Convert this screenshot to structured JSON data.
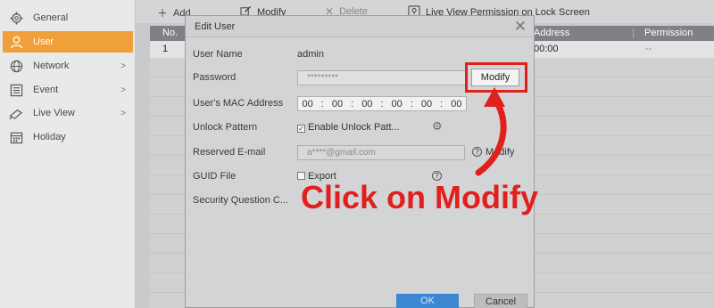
{
  "sidebar": {
    "items": [
      {
        "label": "General",
        "icon": "gear-icon"
      },
      {
        "label": "User",
        "icon": "user-icon",
        "active": true
      },
      {
        "label": "Network",
        "icon": "globe-icon",
        "chevron": ">"
      },
      {
        "label": "Event",
        "icon": "list-icon",
        "chevron": ">"
      },
      {
        "label": "Live View",
        "icon": "camera-icon",
        "chevron": ">"
      },
      {
        "label": "Holiday",
        "icon": "calendar-icon"
      }
    ]
  },
  "toolbar": {
    "add_label": "Add",
    "modify_label": "Modify",
    "delete_label": "Delete",
    "live_view_label": "Live View Permission on Lock Screen"
  },
  "table": {
    "headers": {
      "no": "No.",
      "address": "Address",
      "permission": "Permission"
    },
    "rows": [
      {
        "no": "1",
        "address": "00:00",
        "permission": "--"
      }
    ]
  },
  "dialog": {
    "title": "Edit User",
    "close_glyph": "✕",
    "user_name_label": "User Name",
    "user_name_value": "admin",
    "password_label": "Password",
    "password_value": "*********",
    "modify_label": "Modify",
    "mac_label": "User's MAC Address",
    "mac_octets": [
      "00",
      "00",
      "00",
      "00",
      "00",
      "00"
    ],
    "mac_separator": ":",
    "unlock_label": "Unlock Pattern",
    "unlock_checkbox_label": "Enable Unlock Patt...",
    "reserved_email_label": "Reserved E-mail",
    "reserved_email_value": "a****@gmail.com",
    "email_modify_label": "Modify",
    "guid_label": "GUID File",
    "guid_checkbox_label": "Export",
    "security_label": "Security Question C...",
    "ok_label": "OK",
    "cancel_label": "Cancel"
  },
  "annotation": {
    "text": "Click on Modify",
    "color": "#e0201c"
  },
  "colors": {
    "accent": "#f0a03a",
    "ok_button": "#3b87d2",
    "highlight": "#e0201c"
  }
}
